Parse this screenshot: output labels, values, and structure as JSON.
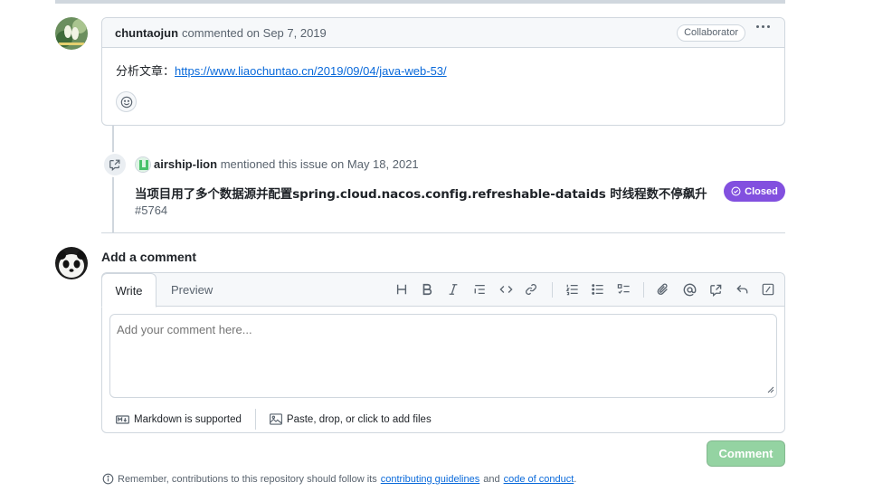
{
  "comment": {
    "author": "chuntaojun",
    "meta": "commented on Sep 7, 2019",
    "badge": "Collaborator",
    "body_label": "分析文章：",
    "body_link": "https://www.liaochuntao.cn/2019/09/04/java-web-53/"
  },
  "mention": {
    "actor": "airship-lion",
    "text": "mentioned this issue on May 18, 2021",
    "issue_title": "当项目用了多个数据源并配置spring.cloud.nacos.config.refreshable-dataids 时线程数不停飙升",
    "issue_number": "#5764",
    "status": "Closed",
    "status_color": "#8250df"
  },
  "composer": {
    "title": "Add a comment",
    "tab_write": "Write",
    "tab_preview": "Preview",
    "placeholder": "Add your comment here...",
    "markdown_note": "Markdown is supported",
    "attach_note": "Paste, drop, or click to add files",
    "submit_label": "Comment",
    "submit_color": "#94d3a2",
    "toolbar_icons": [
      "heading-icon",
      "bold-icon",
      "italic-icon",
      "quote-icon",
      "code-icon",
      "link-icon",
      "numbered-list-icon",
      "unordered-list-icon",
      "task-list-icon",
      "attach-icon",
      "mention-icon",
      "reference-icon",
      "reply-icon",
      "slash-command-icon"
    ]
  },
  "footer": {
    "prefix": "Remember, contributions to this repository should follow its",
    "link1": "contributing guidelines",
    "middle": "and",
    "link2": "code of conduct",
    "suffix": "."
  }
}
